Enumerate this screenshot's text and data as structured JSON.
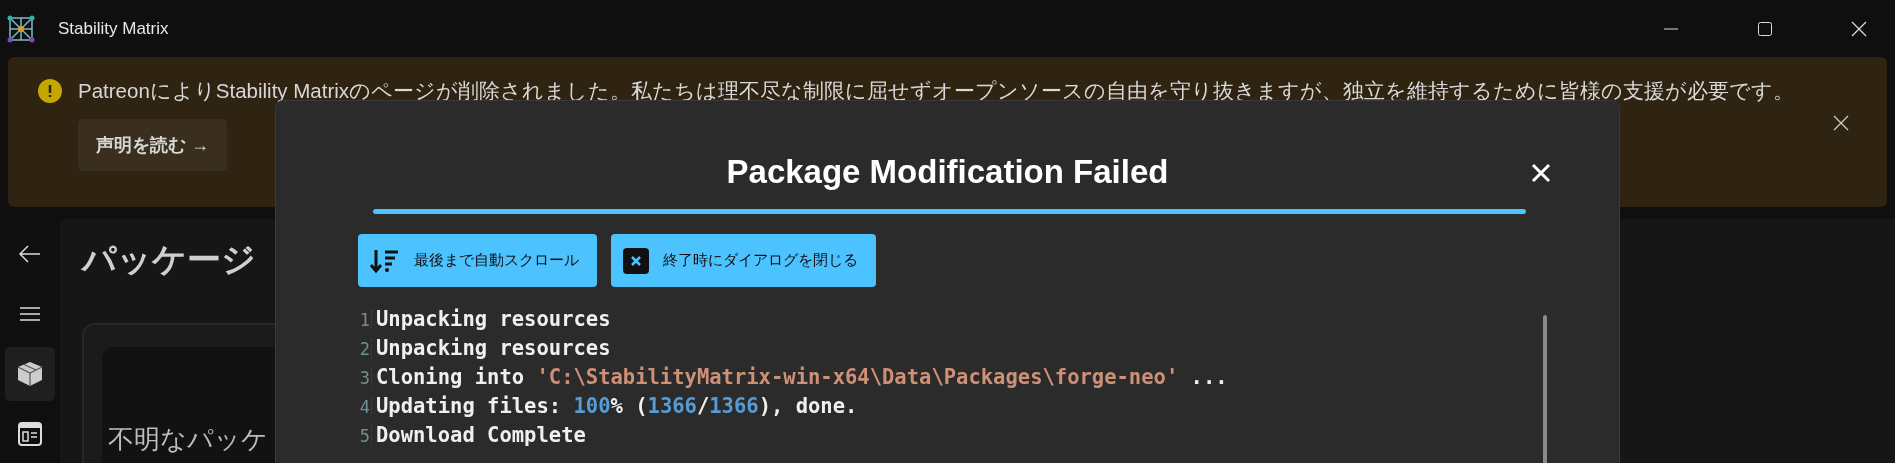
{
  "window": {
    "title": "Stability Matrix"
  },
  "banner": {
    "message": "PatreonによりStability Matrixのページが削除されました。私たちは理不尽な制限に屈せずオープンソースの自由を守り抜きますが、独立を維持するために皆様の支援が必要です。",
    "button": "声明を読む →"
  },
  "sidebar": {
    "items": [
      {
        "kind": "back",
        "selected": false
      },
      {
        "kind": "menu",
        "selected": false
      },
      {
        "kind": "package",
        "selected": true
      },
      {
        "kind": "browser",
        "selected": false
      }
    ]
  },
  "page": {
    "title": "パッケージ",
    "card_text": "不明なパッケ"
  },
  "dialog": {
    "title": "Package Modification Failed",
    "buttons": [
      {
        "kind": "scroll",
        "label": "最後まで自動スクロール"
      },
      {
        "kind": "close",
        "label": "終了時にダイアログを閉じる"
      }
    ],
    "log": [
      {
        "number": "1",
        "parts": [
          {
            "kind": "text",
            "text": "Unpacking resources"
          }
        ]
      },
      {
        "number": "2",
        "parts": [
          {
            "kind": "text",
            "text": "Unpacking resources"
          }
        ]
      },
      {
        "number": "3",
        "parts": [
          {
            "kind": "text",
            "text": "Cloning into "
          },
          {
            "kind": "string",
            "text": "'C:\\StabilityMatrix-win-x64\\Data\\Packages\\forge-neo'"
          },
          {
            "kind": "text",
            "text": " ..."
          }
        ]
      },
      {
        "number": "4",
        "parts": [
          {
            "kind": "text",
            "text": "Updating files: "
          },
          {
            "kind": "number",
            "text": "100"
          },
          {
            "kind": "text",
            "text": "% ("
          },
          {
            "kind": "number",
            "text": "1366"
          },
          {
            "kind": "text",
            "text": "/"
          },
          {
            "kind": "number",
            "text": "1366"
          },
          {
            "kind": "text",
            "text": "), done."
          }
        ]
      },
      {
        "number": "5",
        "parts": [
          {
            "kind": "text",
            "text": "Download Complete"
          }
        ]
      }
    ]
  }
}
